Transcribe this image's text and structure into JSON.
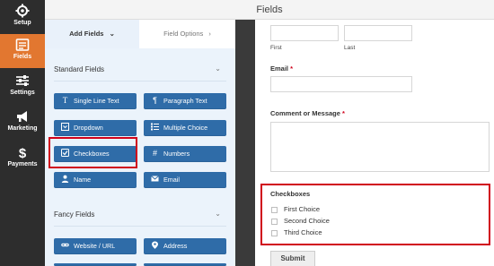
{
  "nav": {
    "items": [
      {
        "label": "Setup",
        "icon": "gear-icon"
      },
      {
        "label": "Fields",
        "icon": "fields-list-icon"
      },
      {
        "label": "Settings",
        "icon": "sliders-icon"
      },
      {
        "label": "Marketing",
        "icon": "megaphone-icon"
      },
      {
        "label": "Payments",
        "icon": "dollar-icon"
      }
    ],
    "active_label": "Fields"
  },
  "header": {
    "title": "Fields"
  },
  "panel": {
    "tabs": [
      {
        "label": "Add Fields"
      },
      {
        "label": "Field Options"
      }
    ],
    "standard": {
      "title": "Standard Fields",
      "buttons": [
        {
          "label": "Single Line Text",
          "icon": "text-input-icon"
        },
        {
          "label": "Paragraph Text",
          "icon": "paragraph-icon"
        },
        {
          "label": "Dropdown",
          "icon": "dropdown-icon"
        },
        {
          "label": "Multiple Choice",
          "icon": "radio-list-icon"
        },
        {
          "label": "Checkboxes",
          "icon": "checkbox-icon"
        },
        {
          "label": "Numbers",
          "icon": "hash-icon"
        },
        {
          "label": "Name",
          "icon": "user-icon"
        },
        {
          "label": "Email",
          "icon": "envelope-icon"
        }
      ]
    },
    "fancy": {
      "title": "Fancy Fields",
      "buttons": [
        {
          "label": "Website / URL",
          "icon": "link-icon"
        },
        {
          "label": "Address",
          "icon": "map-pin-icon"
        }
      ]
    }
  },
  "preview": {
    "name_sublabels": {
      "first": "First",
      "last": "Last"
    },
    "email": {
      "label": "Email",
      "required_mark": "*"
    },
    "comment": {
      "label": "Comment or Message",
      "required_mark": "*"
    },
    "checkboxes": {
      "label": "Checkboxes",
      "choices": [
        "First Choice",
        "Second Choice",
        "Third Choice"
      ]
    },
    "submit_label": "Submit"
  },
  "colors": {
    "nav_bg": "#2d2d2d",
    "nav_active": "#e27730",
    "field_button": "#2f6ca8",
    "panel_bg": "#ebf3fb",
    "highlight": "#d0021b"
  }
}
